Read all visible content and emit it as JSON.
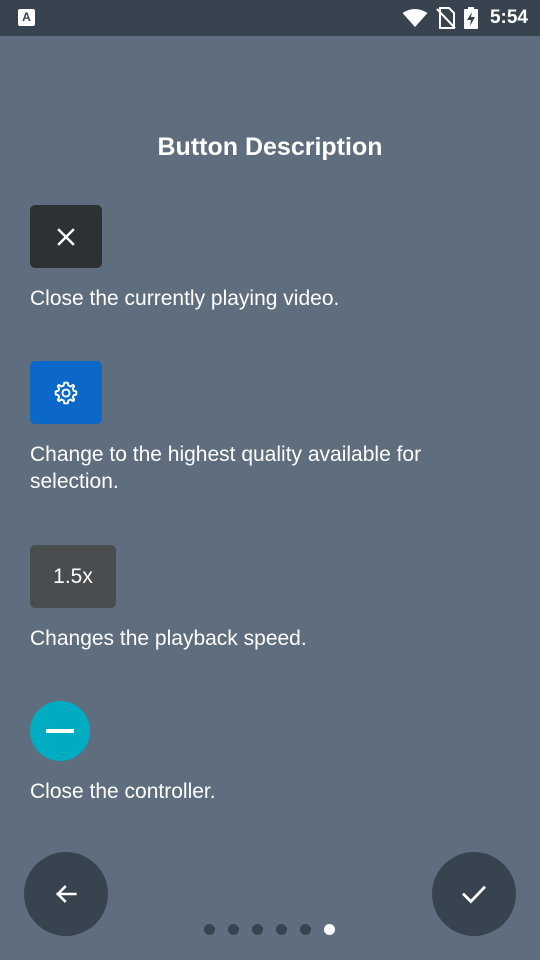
{
  "status_bar": {
    "app_icon_letter": "A",
    "time": "5:54",
    "icons": [
      "wifi-icon",
      "no-sim-icon",
      "battery-charging-icon"
    ]
  },
  "title": "Button Description",
  "items": [
    {
      "sample_icon": "close-icon",
      "description": "Close the currently playing video.",
      "color": "#2e3134"
    },
    {
      "sample_icon": "gear-icon",
      "description": "Change to the highest quality available for selection.",
      "color": "#0c68c8"
    },
    {
      "sample_label": "1.5x",
      "description": "Changes the playback speed.",
      "color": "#4a4d50"
    },
    {
      "sample_icon": "minus-icon",
      "description": "Close the controller.",
      "color": "#00acc1"
    }
  ],
  "navigation": {
    "back_icon": "arrow-left-icon",
    "done_icon": "checkmark-icon",
    "page_count": 6,
    "current_page": 6
  }
}
